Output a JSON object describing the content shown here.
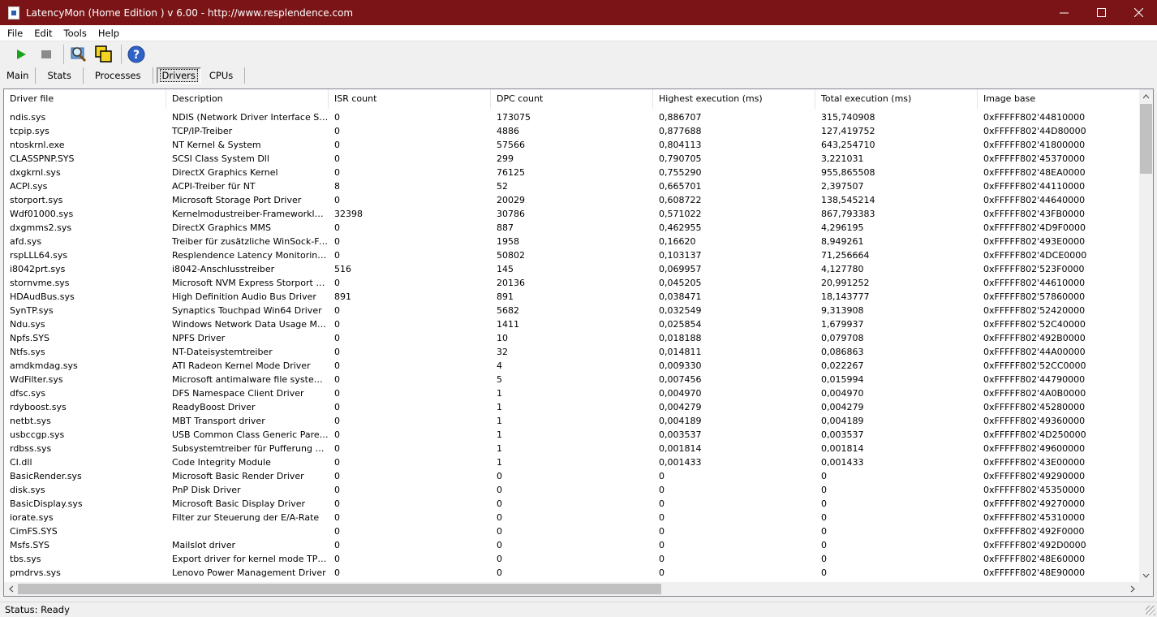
{
  "window": {
    "title": "LatencyMon  (Home Edition )  v 6.00 - http://www.resplendence.com"
  },
  "menu": [
    "File",
    "Edit",
    "Tools",
    "Help"
  ],
  "toolbar": {
    "icons": [
      "play-icon",
      "stop-icon",
      "search-driver-icon",
      "windows-icon",
      "help-icon"
    ]
  },
  "tabs": [
    "Main",
    "Stats",
    "Processes",
    "Drivers",
    "CPUs"
  ],
  "active_tab": "Drivers",
  "table": {
    "columns": [
      "Driver file",
      "Description",
      "ISR count",
      "DPC count",
      "Highest execution (ms)",
      "Total execution (ms)",
      "Image base"
    ],
    "rows": [
      [
        "ndis.sys",
        "NDIS (Network Driver Interface Spe...",
        "0",
        "173075",
        "0,886707",
        "315,740908",
        "0xFFFFF802'44810000"
      ],
      [
        "tcpip.sys",
        "TCP/IP-Treiber",
        "0",
        "4886",
        "0,877688",
        "127,419752",
        "0xFFFFF802'44D80000"
      ],
      [
        "ntoskrnl.exe",
        "NT Kernel & System",
        "0",
        "57566",
        "0,804113",
        "643,254710",
        "0xFFFFF802'41800000"
      ],
      [
        "CLASSPNP.SYS",
        "SCSI Class System Dll",
        "0",
        "299",
        "0,790705",
        "3,221031",
        "0xFFFFF802'45370000"
      ],
      [
        "dxgkrnl.sys",
        "DirectX Graphics Kernel",
        "0",
        "76125",
        "0,755290",
        "955,865508",
        "0xFFFFF802'48EA0000"
      ],
      [
        "ACPI.sys",
        "ACPI-Treiber für NT",
        "8",
        "52",
        "0,665701",
        "2,397507",
        "0xFFFFF802'44110000"
      ],
      [
        "storport.sys",
        "Microsoft Storage Port Driver",
        "0",
        "20029",
        "0,608722",
        "138,545214",
        "0xFFFFF802'44640000"
      ],
      [
        "Wdf01000.sys",
        "Kernelmodustreiber-Frameworklaufzeit",
        "32398",
        "30786",
        "0,571022",
        "867,793383",
        "0xFFFFF802'43FB0000"
      ],
      [
        "dxgmms2.sys",
        "DirectX Graphics MMS",
        "0",
        "887",
        "0,462955",
        "4,296195",
        "0xFFFFF802'4D9F0000"
      ],
      [
        "afd.sys",
        "Treiber für zusätzliche WinSock-Fun...",
        "0",
        "1958",
        "0,16620",
        "8,949261",
        "0xFFFFF802'493E0000"
      ],
      [
        "rspLLL64.sys",
        "Resplendence Latency Monitoring a...",
        "0",
        "50802",
        "0,103137",
        "71,256664",
        "0xFFFFF802'4DCE0000"
      ],
      [
        "i8042prt.sys",
        "i8042-Anschlusstreiber",
        "516",
        "145",
        "0,069957",
        "4,127780",
        "0xFFFFF802'523F0000"
      ],
      [
        "stornvme.sys",
        "Microsoft NVM Express Storport Mini...",
        "0",
        "20136",
        "0,045205",
        "20,991252",
        "0xFFFFF802'44610000"
      ],
      [
        "HDAudBus.sys",
        "High Definition Audio Bus Driver",
        "891",
        "891",
        "0,038471",
        "18,143777",
        "0xFFFFF802'57860000"
      ],
      [
        "SynTP.sys",
        "Synaptics Touchpad Win64 Driver",
        "0",
        "5682",
        "0,032549",
        "9,313908",
        "0xFFFFF802'52420000"
      ],
      [
        "Ndu.sys",
        "Windows Network Data Usage Monit...",
        "0",
        "1411",
        "0,025854",
        "1,679937",
        "0xFFFFF802'52C40000"
      ],
      [
        "Npfs.SYS",
        "NPFS Driver",
        "0",
        "10",
        "0,018188",
        "0,079708",
        "0xFFFFF802'492B0000"
      ],
      [
        "Ntfs.sys",
        "NT-Dateisystemtreiber",
        "0",
        "32",
        "0,014811",
        "0,086863",
        "0xFFFFF802'44A00000"
      ],
      [
        "amdkmdag.sys",
        "ATI Radeon Kernel Mode Driver",
        "0",
        "4",
        "0,009330",
        "0,022267",
        "0xFFFFF802'52CC0000"
      ],
      [
        "WdFilter.sys",
        "Microsoft antimalware file system filt...",
        "0",
        "5",
        "0,007456",
        "0,015994",
        "0xFFFFF802'44790000"
      ],
      [
        "dfsc.sys",
        "DFS Namespace Client Driver",
        "0",
        "1",
        "0,004970",
        "0,004970",
        "0xFFFFF802'4A0B0000"
      ],
      [
        "rdyboost.sys",
        "ReadyBoost Driver",
        "0",
        "1",
        "0,004279",
        "0,004279",
        "0xFFFFF802'45280000"
      ],
      [
        "netbt.sys",
        "MBT Transport driver",
        "0",
        "1",
        "0,004189",
        "0,004189",
        "0xFFFFF802'49360000"
      ],
      [
        "usbccgp.sys",
        "USB Common Class Generic Parent ...",
        "0",
        "1",
        "0,003537",
        "0,003537",
        "0xFFFFF802'4D250000"
      ],
      [
        "rdbss.sys",
        "Subsystemtreiber für Pufferung des...",
        "0",
        "1",
        "0,001814",
        "0,001814",
        "0xFFFFF802'49600000"
      ],
      [
        "CI.dll",
        "Code Integrity Module",
        "0",
        "1",
        "0,001433",
        "0,001433",
        "0xFFFFF802'43E00000"
      ],
      [
        "BasicRender.sys",
        "Microsoft Basic Render Driver",
        "0",
        "0",
        "0",
        "0",
        "0xFFFFF802'49290000"
      ],
      [
        "disk.sys",
        "PnP Disk Driver",
        "0",
        "0",
        "0",
        "0",
        "0xFFFFF802'45350000"
      ],
      [
        "BasicDisplay.sys",
        "Microsoft Basic Display Driver",
        "0",
        "0",
        "0",
        "0",
        "0xFFFFF802'49270000"
      ],
      [
        "iorate.sys",
        "Filter zur Steuerung der E/A-Rate",
        "0",
        "0",
        "0",
        "0",
        "0xFFFFF802'45310000"
      ],
      [
        "CimFS.SYS",
        "",
        "0",
        "0",
        "0",
        "0",
        "0xFFFFF802'492F0000"
      ],
      [
        "Msfs.SYS",
        "Mailslot driver",
        "0",
        "0",
        "0",
        "0",
        "0xFFFFF802'492D0000"
      ],
      [
        "tbs.sys",
        "Export driver for kernel mode TPM API",
        "0",
        "0",
        "0",
        "0",
        "0xFFFFF802'48E60000"
      ],
      [
        "pmdrvs.sys",
        "Lenovo Power Management Driver",
        "0",
        "0",
        "0",
        "0",
        "0xFFFFF802'48E90000"
      ]
    ]
  },
  "status": {
    "text": "Status: Ready"
  }
}
